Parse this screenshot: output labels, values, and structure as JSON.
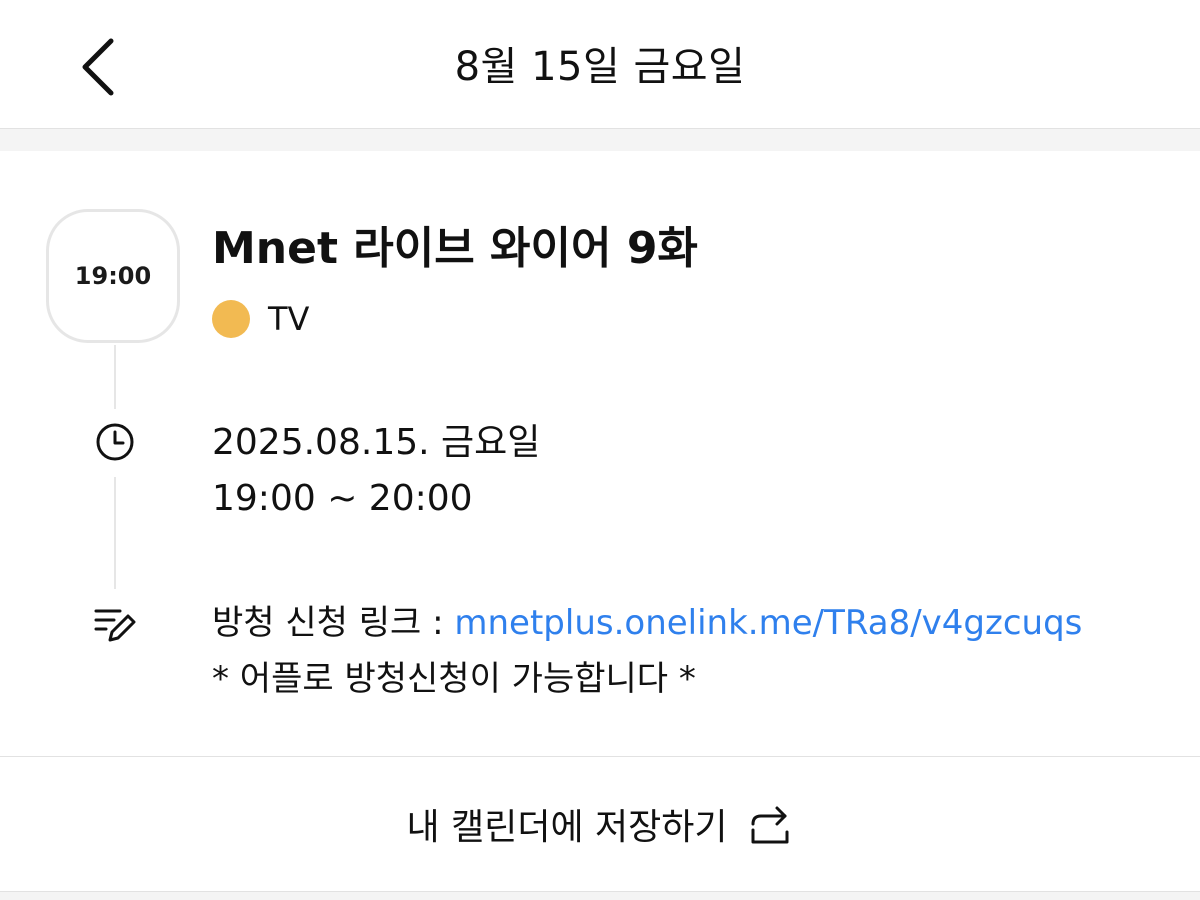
{
  "header": {
    "title": "8월 15일 금요일",
    "back_icon": "chevron-left-icon"
  },
  "event": {
    "time_badge": "19:00",
    "title": "Mnet 라이브 와이어 9화",
    "category": {
      "label": "TV",
      "color": "#F2BA52"
    },
    "date_line": "2025.08.15. 금요일",
    "time_range": "19:00 ~ 20:00",
    "memo": {
      "prefix": "방청 신청 링크 : ",
      "link": "mnetplus.onelink.me/TRa8/v4gzcuqs",
      "note": "* 어플로 방청신청이 가능합니다 *"
    }
  },
  "footer": {
    "save_label": "내 캘린더에 저장하기",
    "save_icon": "share-arrow-icon"
  },
  "colors": {
    "link": "#2F80ED",
    "category_dot": "#F2BA52"
  }
}
